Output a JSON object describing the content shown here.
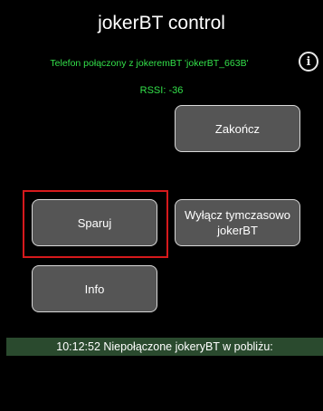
{
  "app": {
    "title": "jokerBT control"
  },
  "status": {
    "connection": "Telefon połączony z jokeremBT 'jokerBT_663B'",
    "rssi": "RSSI: -36"
  },
  "buttons": {
    "finish_label": "Zakończ",
    "pair_label": "Sparuj",
    "disable_line1": "Wyłącz tymczasowo",
    "disable_line2": "jokerBT",
    "info_label": "Info"
  },
  "icons": {
    "info": "info-icon",
    "info_glyph": "i"
  },
  "log": {
    "message": "10:12:52  Niepołączone jokeryBT w pobliżu:"
  },
  "colors": {
    "background": "#000000",
    "status_text": "#33e04a",
    "button_bg": "#555555",
    "highlight": "#d6191c",
    "log_bar": "#2a4a2e"
  }
}
